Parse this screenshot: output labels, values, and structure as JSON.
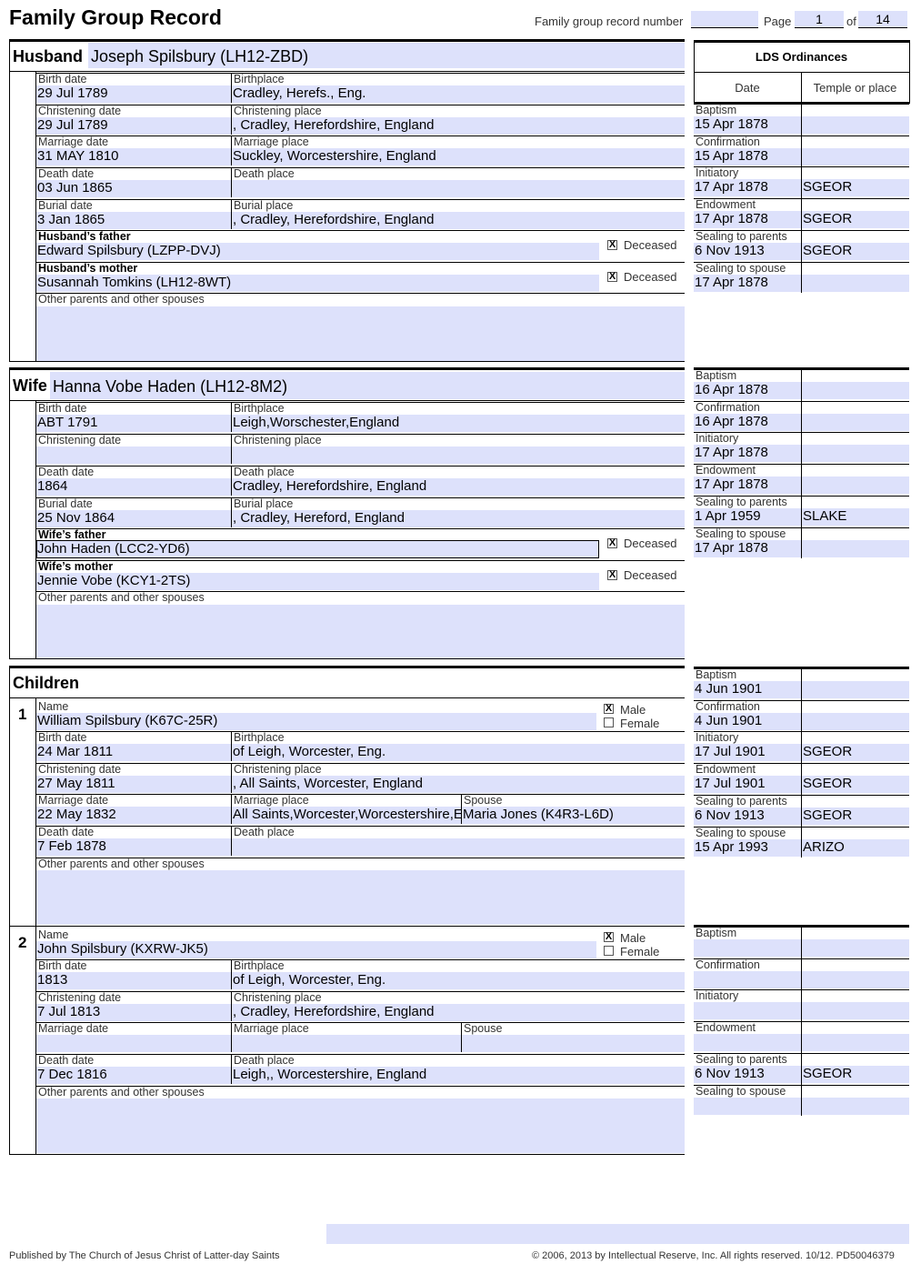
{
  "header": {
    "title": "Family Group Record",
    "record_number_label": "Family group record number",
    "record_number": "",
    "page_label": "Page",
    "page": "1",
    "of_label": "of",
    "total_pages": "14"
  },
  "lds": {
    "title": "LDS Ordinances",
    "date_col": "Date",
    "temple_col": "Temple or place"
  },
  "labels": {
    "birth_date": "Birth date",
    "birthplace": "Birthplace",
    "christening_date": "Christening date",
    "christening_place": "Christening place",
    "marriage_date": "Marriage date",
    "marriage_place": "Marriage place",
    "death_date": "Death date",
    "death_place": "Death place",
    "burial_date": "Burial date",
    "burial_place": "Burial place",
    "other_parents": "Other parents and other spouses",
    "deceased": "Deceased",
    "name": "Name",
    "spouse": "Spouse",
    "male": "Male",
    "female": "Female",
    "baptism": "Baptism",
    "confirmation": "Confirmation",
    "initiatory": "Initiatory",
    "endowment": "Endowment",
    "sealing_parents": "Sealing to parents",
    "sealing_spouse": "Sealing to spouse"
  },
  "husband": {
    "section_label": "Husband",
    "name": "Joseph Spilsbury (LH12-ZBD)",
    "birth_date": "29 Jul 1789",
    "birthplace": "Cradley, Herefs., Eng.",
    "christening_date": "29 Jul 1789",
    "christening_place": ", Cradley, Herefordshire, England",
    "marriage_date": "31 MAY 1810",
    "marriage_place": "Suckley, Worcestershire, England",
    "death_date": "03 Jun 1865",
    "death_place": "",
    "burial_date": "3 Jan 1865",
    "burial_place": ", Cradley, Herefordshire, England",
    "father_label": "Husband’s father",
    "father": "Edward Spilsbury (LZPP-DVJ)",
    "father_deceased": "X",
    "mother_label": "Husband’s mother",
    "mother": "Susannah Tomkins (LH12-8WT)",
    "mother_deceased": "X",
    "other": "",
    "ordinances": {
      "baptism": [
        "15 Apr 1878",
        ""
      ],
      "confirmation": [
        "15 Apr 1878",
        ""
      ],
      "initiatory": [
        "17 Apr 1878",
        "SGEOR"
      ],
      "endowment": [
        "17 Apr 1878",
        "SGEOR"
      ],
      "sealing_parents": [
        "6 Nov 1913",
        "SGEOR"
      ],
      "sealing_spouse": [
        "17 Apr 1878",
        ""
      ]
    }
  },
  "wife": {
    "section_label": "Wife",
    "name": "Hanna Vobe Haden (LH12-8M2)",
    "birth_date": "ABT 1791",
    "birthplace": "Leigh,Worschester,England",
    "christening_date": "",
    "christening_place": "",
    "death_date": "1864",
    "death_place": "Cradley, Herefordshire, England",
    "burial_date": "25 Nov 1864",
    "burial_place": ", Cradley, Hereford, England",
    "father_label": "Wife’s father",
    "father": "John Haden (LCC2-YD6)",
    "father_deceased": "X",
    "mother_label": "Wife’s mother",
    "mother": "Jennie Vobe (KCY1-2TS)",
    "mother_deceased": "X",
    "other": "",
    "ordinances": {
      "baptism": [
        "16 Apr 1878",
        ""
      ],
      "confirmation": [
        "16 Apr 1878",
        ""
      ],
      "initiatory": [
        "17 Apr 1878",
        ""
      ],
      "endowment": [
        "17 Apr 1878",
        ""
      ],
      "sealing_parents": [
        "1 Apr 1959",
        "SLAKE"
      ],
      "sealing_spouse": [
        "17 Apr 1878",
        ""
      ]
    }
  },
  "children_title": "Children",
  "children": [
    {
      "number": "1",
      "name": "William Spilsbury (K67C-25R)",
      "male": "X",
      "female": "",
      "birth_date": "24 Mar 1811",
      "birthplace": "of Leigh, Worcester, Eng.",
      "christening_date": "27 May 1811",
      "christening_place": ", All Saints, Worcester, England",
      "marriage_date": "22 May 1832",
      "marriage_place": "All Saints,Worcester,Worcestershire,E",
      "spouse": "Maria Jones (K4R3-L6D)",
      "death_date": "7 Feb 1878",
      "death_place": "",
      "other": "",
      "ordinances": {
        "baptism": [
          "4 Jun 1901",
          ""
        ],
        "confirmation": [
          "4 Jun 1901",
          ""
        ],
        "initiatory": [
          "17 Jul 1901",
          "SGEOR"
        ],
        "endowment": [
          "17 Jul 1901",
          "SGEOR"
        ],
        "sealing_parents": [
          "6 Nov 1913",
          "SGEOR"
        ],
        "sealing_spouse": [
          "15 Apr 1993",
          "ARIZO"
        ]
      }
    },
    {
      "number": "2",
      "name": "John Spilsbury (KXRW-JK5)",
      "male": "X",
      "female": "",
      "birth_date": "1813",
      "birthplace": "of Leigh, Worcester, Eng.",
      "christening_date": "7 Jul 1813",
      "christening_place": ", Cradley, Herefordshire, England",
      "marriage_date": "",
      "marriage_place": "",
      "spouse": "",
      "death_date": "7 Dec 1816",
      "death_place": "Leigh,, Worcestershire, England",
      "other": "",
      "ordinances": {
        "baptism": [
          "",
          ""
        ],
        "confirmation": [
          "",
          ""
        ],
        "initiatory": [
          "",
          ""
        ],
        "endowment": [
          "",
          ""
        ],
        "sealing_parents": [
          "6 Nov 1913",
          "SGEOR"
        ],
        "sealing_spouse": [
          "",
          ""
        ]
      }
    }
  ],
  "footer": {
    "left": "Published by The Church of Jesus Christ of Latter-day Saints",
    "right": "© 2006, 2013 by Intellectual Reserve, Inc. All rights reserved. 10/12. PD50046379"
  },
  "colors": {
    "field_fill": "#dde1fb"
  }
}
